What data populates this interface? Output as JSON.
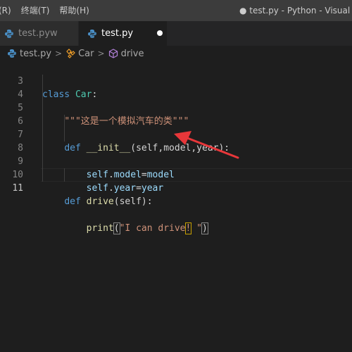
{
  "menu": {
    "items": [
      "(R)",
      "终端(T)",
      "帮助(H)"
    ]
  },
  "window": {
    "title": "● test.py - Python - Visual Stu"
  },
  "tabs": [
    {
      "label": "test.pyw",
      "active": false,
      "dirty": false
    },
    {
      "label": "test.py",
      "active": true,
      "dirty": true
    }
  ],
  "breadcrumb": {
    "file": "test.py",
    "separator": ">",
    "class": "Car",
    "method": "drive"
  },
  "editor": {
    "current_line": 11,
    "line_numbers": [
      "3",
      "4",
      "5",
      "6",
      "7",
      "8",
      "9",
      "10",
      "11"
    ],
    "code": {
      "l3_kw": "class",
      "l3_name": "Car",
      "l3_colon": ":",
      "l4_doc": "\"\"\"这是一个模拟汽车的类\"\"\"",
      "l6_kw": "def",
      "l6_name": "__init__",
      "l6_params": "(self,model,year):",
      "l7_self": "self",
      "l7_dot": ".",
      "l7_attr": "model",
      "l7_eq": "=",
      "l7_val": "model",
      "l8_self": "self",
      "l8_dot": ".",
      "l8_attr": "year",
      "l8_eq": "=",
      "l8_val": "year",
      "l10_kw": "def",
      "l10_name": "drive",
      "l10_params": "(self):",
      "l11_fn": "print",
      "l11_open": "(",
      "l11_str_a": "\"I can drive",
      "l11_str_b": "!",
      "l11_str_c": " \"",
      "l11_close": ")"
    }
  },
  "colors": {
    "keyword": "#569cd6",
    "class_name": "#4ec9b0",
    "string": "#ce9178",
    "function": "#dcdcaa",
    "variable": "#9cdcfe",
    "annotation_arrow": "#e8373a"
  }
}
